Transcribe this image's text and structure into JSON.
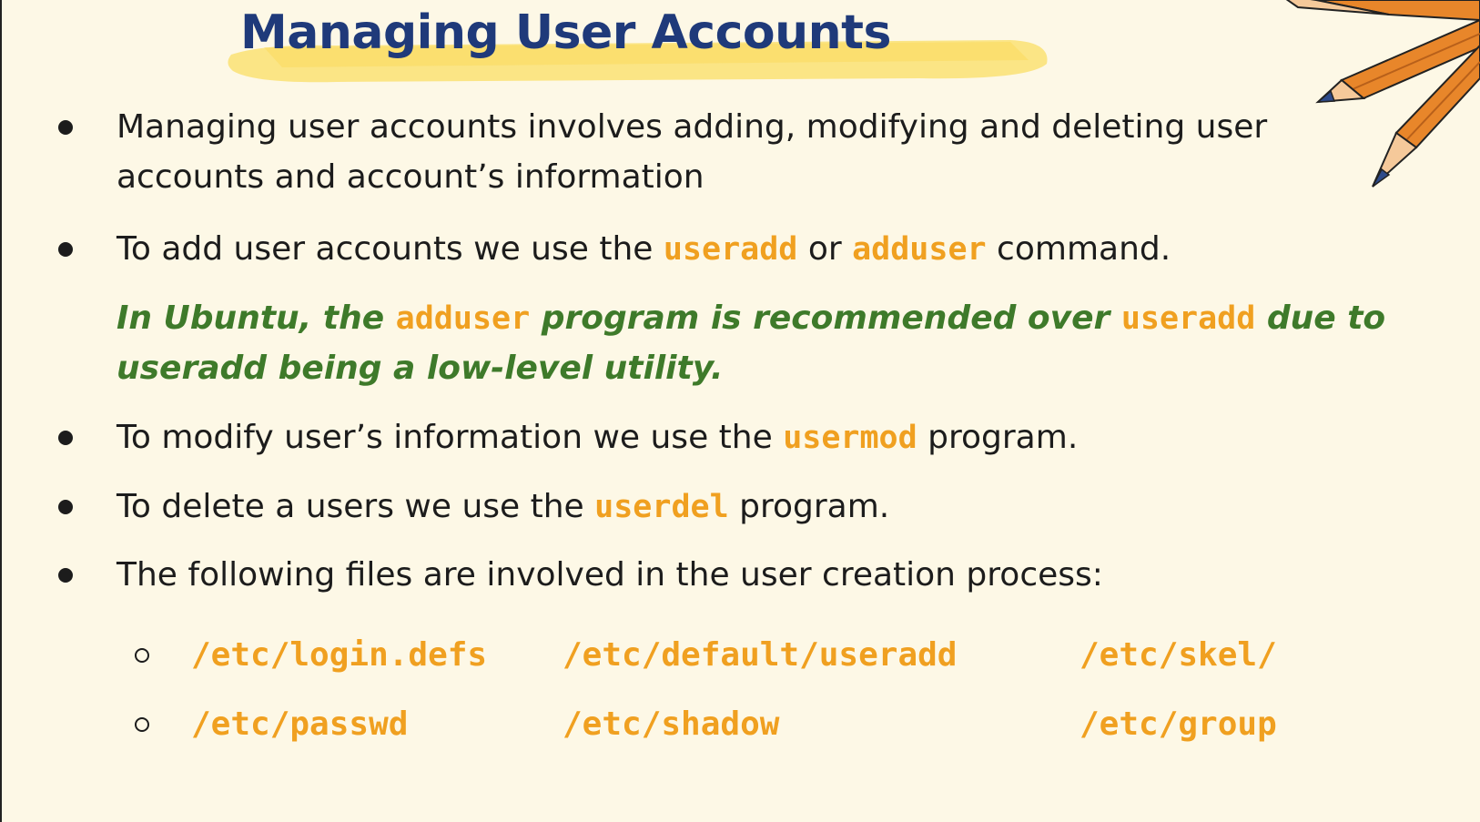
{
  "title": "Managing User Accounts",
  "bullets": {
    "b1_line1": "Managing user accounts involves adding, modifying and deleting user",
    "b1_line2": "accounts and account’s information",
    "b2_pre": "To add user accounts we use the ",
    "b2_cmd1": "useradd",
    "b2_mid": " or ",
    "b2_cmd2": "adduser",
    "b2_post": " command.",
    "note_pre": "In Ubuntu, the ",
    "note_cmd1": "adduser",
    "note_mid": " program is recommended over ",
    "note_cmd2": "useradd",
    "note_post": " due to",
    "note_line2": "useradd being a low-level utility.",
    "b3_pre": "To modify user’s information we use the ",
    "b3_cmd": "usermod",
    "b3_post": " program.",
    "b4_pre": "To delete a users we use the ",
    "b4_cmd": "userdel",
    "b4_post": " program.",
    "b5": "The following files are involved in the user creation process:"
  },
  "files": {
    "row1": [
      "/etc/login.defs",
      "/etc/default/useradd",
      "/etc/skel/"
    ],
    "row2": [
      "/etc/passwd",
      "/etc/shadow",
      "/etc/group"
    ]
  },
  "colors": {
    "title": "#1f3a7a",
    "highlight": "#fbe27a",
    "command": "#f0a020",
    "note": "#3e7a2a",
    "background": "#fdf8e6",
    "pencil": "#e8862a"
  }
}
